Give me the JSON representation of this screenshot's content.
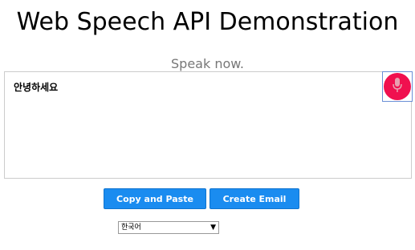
{
  "page": {
    "title": "Web Speech API Demonstration",
    "status": "Speak now."
  },
  "transcript": {
    "text": "안녕하세요"
  },
  "mic": {
    "icon": "microphone-icon",
    "color": "#f0104f"
  },
  "actions": {
    "copy_label": "Copy and Paste",
    "email_label": "Create Email",
    "button_color": "#1a8cf0"
  },
  "language": {
    "selected": "한국어"
  }
}
